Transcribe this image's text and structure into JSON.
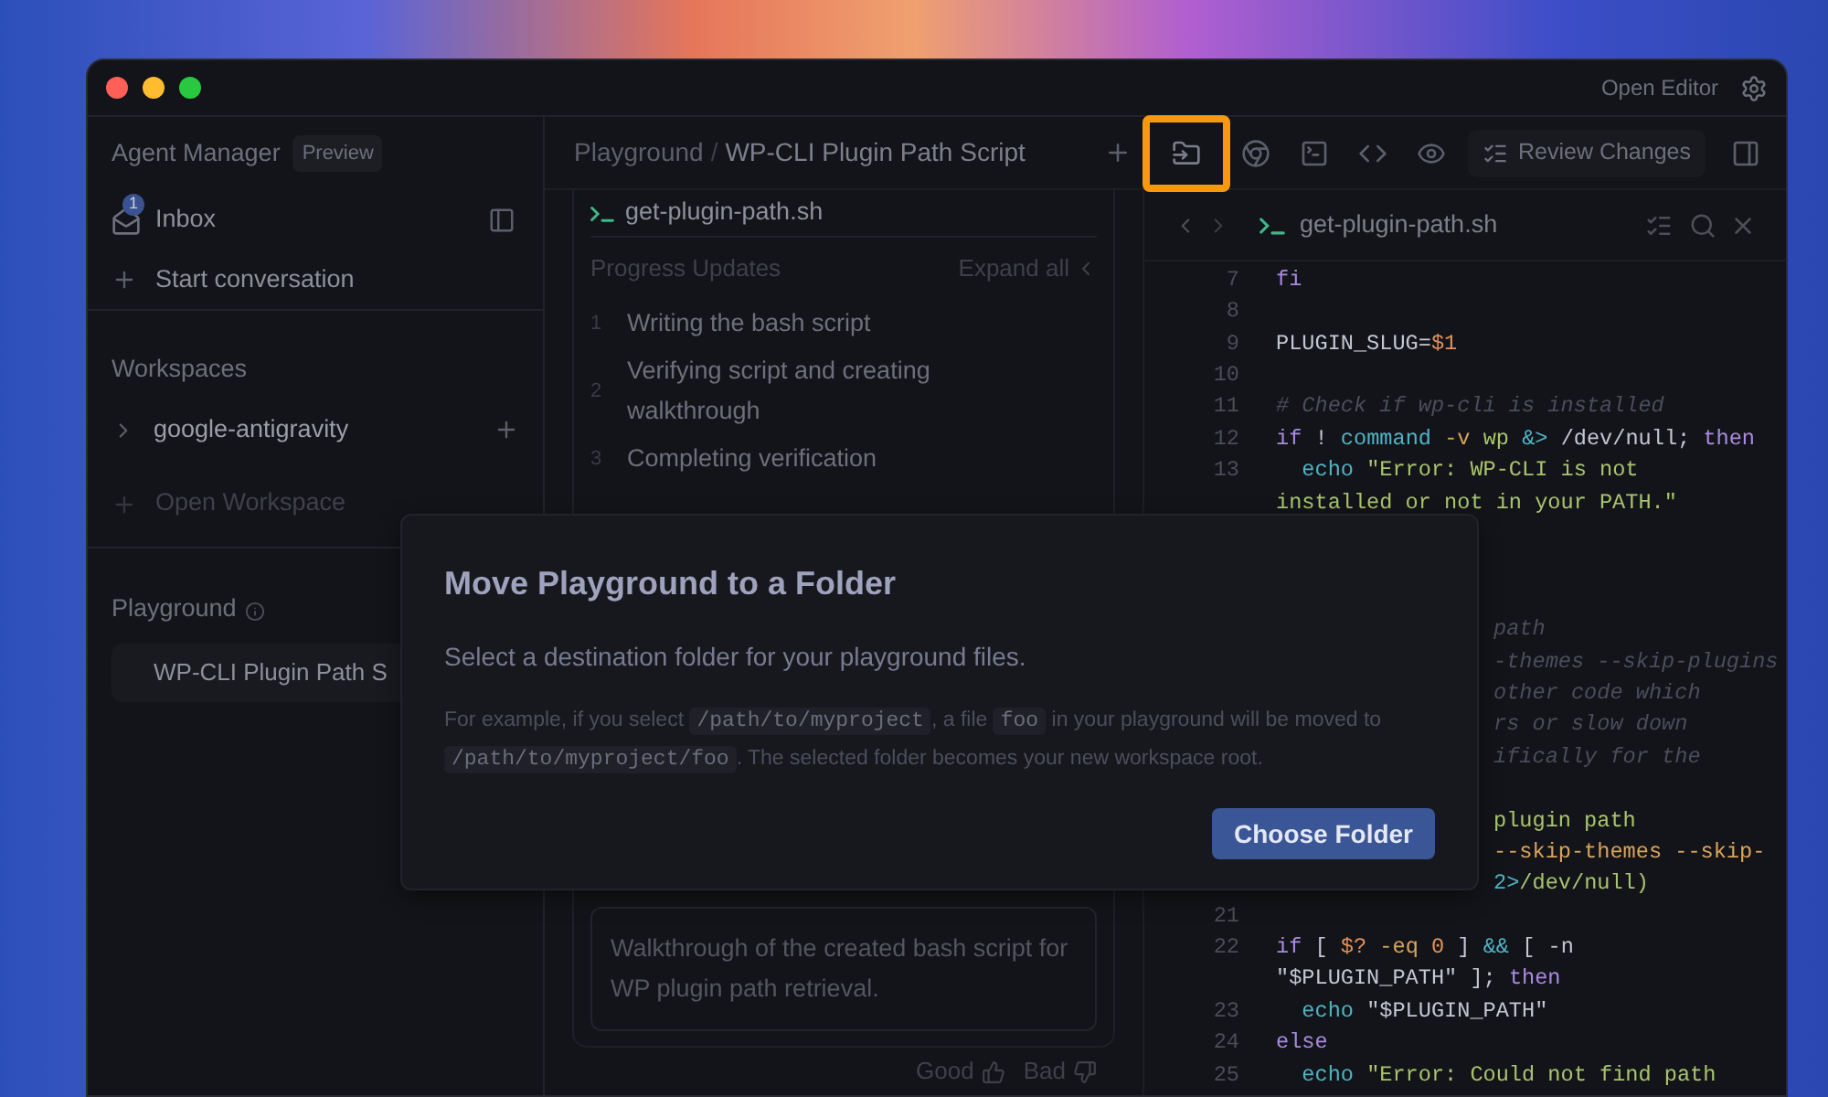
{
  "window": {
    "open_editor": "Open Editor"
  },
  "sidebar": {
    "title": "Agent Manager",
    "badge": "Preview",
    "inbox": {
      "label": "Inbox",
      "count": "1"
    },
    "start": {
      "label": "Start conversation"
    },
    "workspaces": {
      "heading": "Workspaces",
      "items": [
        {
          "label": "google-antigravity",
          "expanded": false
        }
      ],
      "open_workspace": {
        "label": "Open Workspace",
        "disabled": true
      }
    },
    "playground": {
      "heading": "Playground",
      "items": [
        {
          "label": "WP-CLI Plugin Path S",
          "selected": true
        }
      ]
    }
  },
  "toolbar": {
    "breadcrumb": [
      "Playground",
      "WP-CLI Plugin Path Script"
    ],
    "separator": "/",
    "review_button": "Review Changes"
  },
  "task_card": {
    "file": "get-plugin-path.sh",
    "progress_title": "Progress Updates",
    "expand_all": "Expand all",
    "steps": [
      {
        "number": "1",
        "label": "Writing the bash script"
      },
      {
        "number": "2",
        "label": "Verifying script and creating walkthrough"
      },
      {
        "number": "3",
        "label": "Completing verification"
      }
    ],
    "artifact_text": "Walkthrough of the created bash script for WP plugin path retrieval.",
    "feedback": [
      "Good",
      "Bad"
    ]
  },
  "editor": {
    "tab": "get-plugin-path.sh",
    "rows": [
      {
        "number": "7",
        "tokens": [
          {
            "kind": "keyword",
            "text": "fi"
          }
        ]
      },
      {
        "number": "8",
        "tokens": []
      },
      {
        "number": "9",
        "tokens": [
          {
            "kind": "plain",
            "text": "PLUGIN_SLUG="
          },
          {
            "kind": "number",
            "text": "$1"
          }
        ]
      },
      {
        "number": "10",
        "tokens": []
      },
      {
        "number": "11",
        "tokens": [
          {
            "kind": "comment",
            "text": "# Check if wp-cli is installed"
          }
        ]
      },
      {
        "number": "12",
        "tokens": [
          {
            "kind": "keyword",
            "text": "if"
          },
          {
            "kind": "plain",
            "text": " ! "
          },
          {
            "kind": "builtin",
            "text": "command"
          },
          {
            "kind": "flag",
            "text": " -v"
          },
          {
            "kind": "string",
            "text": " wp "
          },
          {
            "kind": "builtin",
            "text": "&>"
          },
          {
            "kind": "plain",
            "text": " /dev/null; "
          },
          {
            "kind": "keyword",
            "text": "then"
          }
        ]
      },
      {
        "number": "13",
        "tokens": [
          {
            "kind": "builtin",
            "text": "  echo"
          },
          {
            "kind": "string",
            "text": " \"Error: WP-CLI is not"
          }
        ]
      },
      {
        "tokens": [
          {
            "kind": "string",
            "text": "installed or not in your PATH.\""
          }
        ]
      },
      {
        "tokens": []
      },
      {
        "tokens": []
      },
      {
        "tokens": []
      },
      {
        "kind": "partial",
        "tokens": [
          {
            "kind": "comment",
            "text": "path"
          }
        ]
      },
      {
        "kind": "partial",
        "tokens": [
          {
            "kind": "comment",
            "text": "-themes --skip-plugins"
          }
        ]
      },
      {
        "kind": "partial",
        "tokens": [
          {
            "kind": "comment",
            "text": "other code which"
          }
        ]
      },
      {
        "kind": "partial",
        "tokens": [
          {
            "kind": "comment",
            "text": "rs or slow down"
          }
        ]
      },
      {
        "kind": "partial",
        "tokens": [
          {
            "kind": "comment",
            "text": "ifically for the"
          }
        ]
      },
      {
        "tokens": []
      },
      {
        "kind": "partial",
        "tokens": [
          {
            "kind": "string",
            "text": "plugin path"
          }
        ]
      },
      {
        "kind": "partial",
        "tokens": [
          {
            "kind": "flag",
            "text": "--skip-themes --skip-"
          }
        ]
      },
      {
        "kind": "partial",
        "tokens": [
          {
            "kind": "builtin",
            "text": "2>"
          },
          {
            "kind": "string",
            "text": "/dev/null)"
          }
        ]
      },
      {
        "number": "21",
        "tokens": []
      },
      {
        "number": "22",
        "tokens": [
          {
            "kind": "keyword",
            "text": "if"
          },
          {
            "kind": "plain",
            "text": " [ "
          },
          {
            "kind": "number",
            "text": "$?"
          },
          {
            "kind": "flag",
            "text": " -eq "
          },
          {
            "kind": "number",
            "text": "0"
          },
          {
            "kind": "plain",
            "text": " ] "
          },
          {
            "kind": "builtin",
            "text": "&&"
          },
          {
            "kind": "plain",
            "text": " [ -n"
          }
        ]
      },
      {
        "tokens": [
          {
            "kind": "plain",
            "text": "\"$PLUGIN_PATH\" ]; "
          },
          {
            "kind": "keyword",
            "text": "then"
          }
        ]
      },
      {
        "number": "23",
        "tokens": [
          {
            "kind": "builtin",
            "text": "  echo"
          },
          {
            "kind": "plain",
            "text": " \"$PLUGIN_PATH\""
          }
        ]
      },
      {
        "number": "24",
        "tokens": [
          {
            "kind": "keyword",
            "text": "else"
          }
        ]
      },
      {
        "number": "25",
        "tokens": [
          {
            "kind": "builtin",
            "text": "  echo"
          },
          {
            "kind": "string",
            "text": " \"Error: Could not find path"
          }
        ]
      }
    ]
  },
  "dialog": {
    "title": "Move Playground to a Folder",
    "subtitle": "Select a destination folder for your playground files.",
    "note": [
      {
        "kind": "text",
        "text": "For example, if you select "
      },
      {
        "kind": "code",
        "text": "/path/to/myproject"
      },
      {
        "kind": "text",
        "text": ", a file "
      },
      {
        "kind": "code",
        "text": "foo"
      },
      {
        "kind": "text",
        "text": " in your playground will be moved to "
      },
      {
        "kind": "code",
        "text": "/path/to/myproject/foo"
      },
      {
        "kind": "text",
        "text": ". The selected folder becomes your new workspace root."
      }
    ],
    "button": "Choose Folder"
  }
}
